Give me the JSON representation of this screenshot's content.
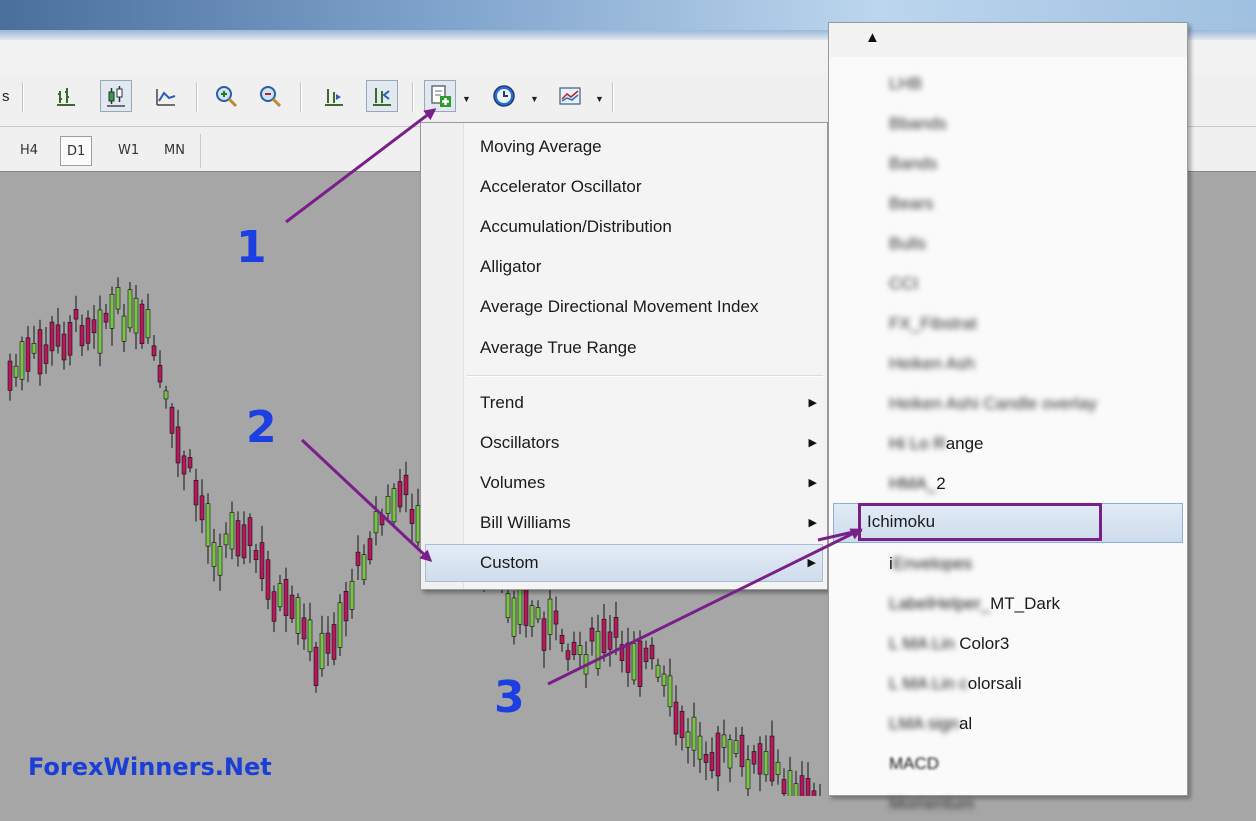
{
  "toolbar": {
    "left_label": "s",
    "icons": [
      "bar-chart-icon",
      "candlestick-icon",
      "line-chart-icon",
      "zoom-in-icon",
      "zoom-out-icon",
      "autoscroll-icon",
      "chart-shift-icon",
      "indicators-icon",
      "periodicity-icon",
      "templates-icon"
    ]
  },
  "periods": [
    "H4",
    "D1",
    "W1",
    "MN"
  ],
  "active_period": "D1",
  "indicators_menu": {
    "items": [
      "Moving Average",
      "Accelerator Oscillator",
      "Accumulation/Distribution",
      "Alligator",
      "Average Directional Movement Index",
      "Average True Range"
    ],
    "groups": [
      "Trend",
      "Oscillators",
      "Volumes",
      "Bill Williams",
      "Custom"
    ],
    "highlighted": "Custom"
  },
  "custom_submenu": {
    "scroll_up_label": "▲",
    "blurred_top_items": 11,
    "items": [
      "Ichimoku",
      "i",
      "MT_Dark",
      "Color3",
      "olorsali",
      "al",
      "MACD"
    ],
    "partial_suffixes": [
      "ange",
      "2"
    ],
    "selected": "Ichimoku"
  },
  "annotations": {
    "step1": "1",
    "step2": "2",
    "step3": "3"
  },
  "watermark": "ForexWinners.Net",
  "colors": {
    "annotation_arrow": "#7a1f8a",
    "step_number": "#1b3fe0",
    "chart_bg": "#a6a6a6",
    "bull_candle": "#7cc24a",
    "bear_candle": "#b5185c"
  }
}
